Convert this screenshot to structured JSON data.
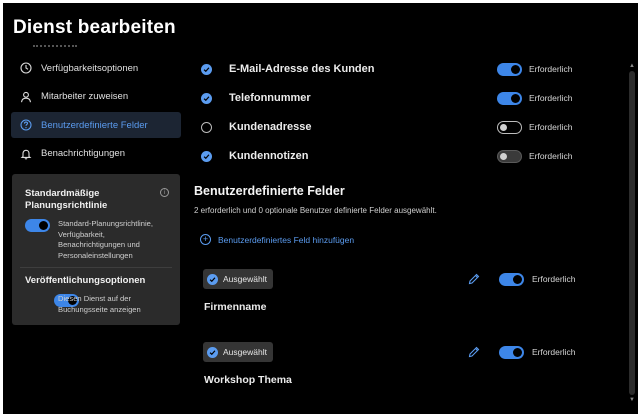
{
  "window": {
    "title": "Dienst bearbeiten"
  },
  "sidebar": {
    "items": [
      {
        "label": "Verfügbarkeitsoptionen",
        "icon": "clock-icon",
        "active": false
      },
      {
        "label": "Mitarbeiter zuweisen",
        "icon": "person-icon",
        "active": false
      },
      {
        "label": "Benutzerdefinierte Felder",
        "icon": "question-circle-icon",
        "active": true
      },
      {
        "label": "Benachrichtigungen",
        "icon": "bell-icon",
        "active": false
      }
    ],
    "policy_card": {
      "title": "Standardmäßige Planungsrichtlinie",
      "info_icon_glyph": "i",
      "toggle_on": true,
      "description": "Standard-Planungsrichtlinie, Verfügbarkeit, Benachrichtigungen und Personaleinstellungen",
      "publish_title": "Veröffentlichungsoptionen",
      "publish_toggle_on": true,
      "publish_description": "Diesen Dienst auf der Buchungsseite anzeigen"
    }
  },
  "fields": [
    {
      "label": "E-Mail-Adresse des Kunden",
      "checked": true,
      "required": true,
      "required_label": "Erforderlich"
    },
    {
      "label": "Telefonnummer",
      "checked": true,
      "required": true,
      "required_label": "Erforderlich"
    },
    {
      "label": "Kundenadresse",
      "checked": false,
      "required": false,
      "required_label": "Erforderlich"
    },
    {
      "label": "Kundennotizen",
      "checked": true,
      "required": false,
      "required_label": "Erforderlich"
    }
  ],
  "custom_section": {
    "title": "Benutzerdefinierte Felder",
    "subtitle": "2 erforderlich und 0 optionale Benutzer definierte Felder ausgewählt.",
    "add_label": "Benutzerdefiniertes Feld hinzufügen",
    "items": [
      {
        "chip_label": "Ausgewählt",
        "name": "Firmenname",
        "required": true,
        "required_label": "Erforderlich"
      },
      {
        "chip_label": "Ausgewählt",
        "name": "Workshop Thema",
        "required": true,
        "required_label": "Erforderlich"
      }
    ]
  },
  "colors": {
    "accent": "#3d86e8",
    "background": "#000000",
    "card": "#2b2b2b",
    "active_nav": "#1c2533"
  }
}
